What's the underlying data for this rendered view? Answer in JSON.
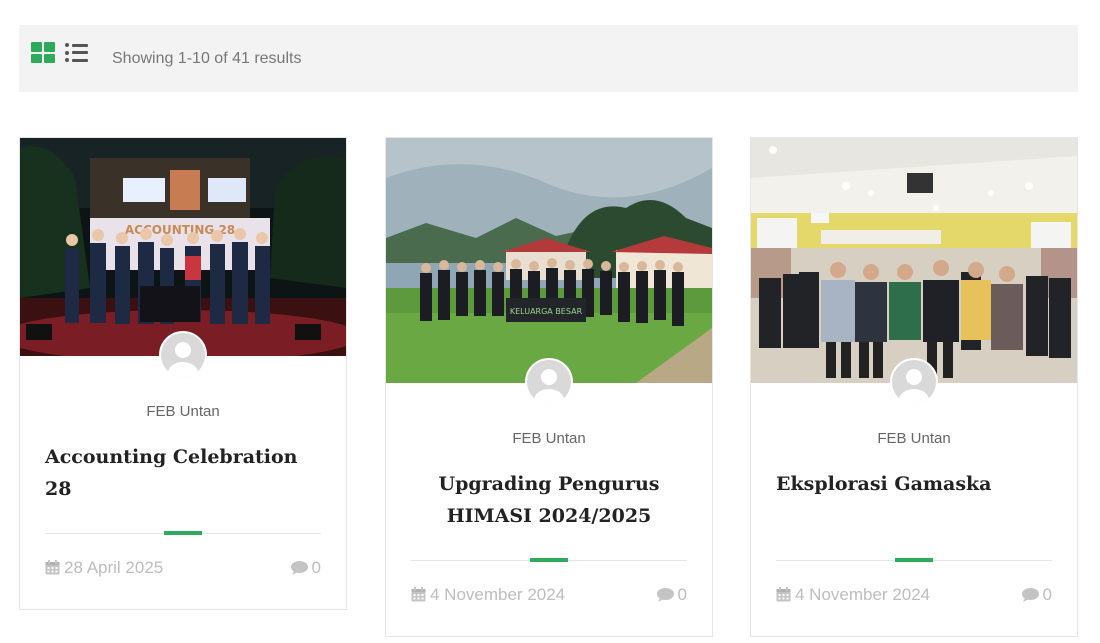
{
  "toolbar": {
    "results_text": "Showing 1-10 of 41 results",
    "active_view": "grid",
    "icons": [
      "grid-view-icon",
      "list-view-icon"
    ],
    "accent_color": "#2eaa5c"
  },
  "posts": [
    {
      "author": "FEB Untan",
      "title": "Accounting Celebration 28",
      "date": "28 April 2025",
      "comments": "0",
      "image_desc": "photo-night-stage-group"
    },
    {
      "author": "FEB Untan",
      "title": "Upgrading Pengurus HIMASI 2024/2025",
      "date": "4 November 2024",
      "comments": "0",
      "image_desc": "photo-outdoor-group-banner"
    },
    {
      "author": "FEB Untan",
      "title": "Eksplorasi Gamaska",
      "date": "4 November 2024",
      "comments": "0",
      "image_desc": "photo-indoor-hall-group"
    }
  ]
}
